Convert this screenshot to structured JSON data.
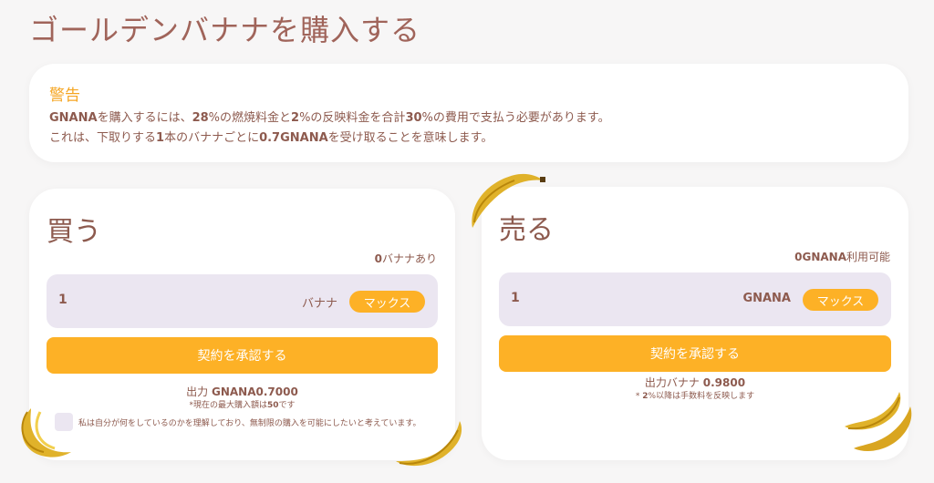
{
  "page": {
    "title": "ゴールデンバナナを購入する"
  },
  "warning": {
    "title": "警告",
    "line1": {
      "token": "GNANA",
      "t1": "を購入するには、",
      "n1": "28",
      "t2": "%の燃焼料金と",
      "n2": "2",
      "t3": "%の反映料金を合計",
      "n3": "30",
      "t4": "%の費用で支払う必要があります。"
    },
    "line2": {
      "t1": "これは、下取りする",
      "n1": "1",
      "t2": "本のバナナごとに",
      "n2": "0.7GNANA",
      "t3": "を受け取ることを意味します。"
    }
  },
  "buy": {
    "title": "買う",
    "balance_value": "0",
    "balance_label": "バナナあり",
    "input_value": "1",
    "unit": "バナナ",
    "max_label": "マックス",
    "approve_label": "契約を承認する",
    "output_label": "出力 ",
    "output_value": "GNANA0.7000",
    "note_prefix": "*",
    "note_text": "現在の最大購入額は",
    "note_value": "50",
    "note_suffix": "です",
    "checkbox_label": "私は自分が何をしているのかを理解しており、無制限の購入を可能にしたいと考えています。"
  },
  "sell": {
    "title": "売る",
    "balance_value": "0GNANA",
    "balance_label": "利用可能",
    "input_value": "1",
    "unit": "GNANA",
    "max_label": "マックス",
    "approve_label": "契約を承認する",
    "output_label": "出力バナナ ",
    "output_value": "0.9800",
    "note_prefix": "* ",
    "note_value": "2",
    "note_text": "%以降は手数料を反映します"
  },
  "colors": {
    "accent": "#fdb126",
    "text": "#8d5a4e",
    "warning": "#f5a623",
    "input_bg": "#ebe6f1"
  },
  "icons": [
    "banana-icon"
  ]
}
